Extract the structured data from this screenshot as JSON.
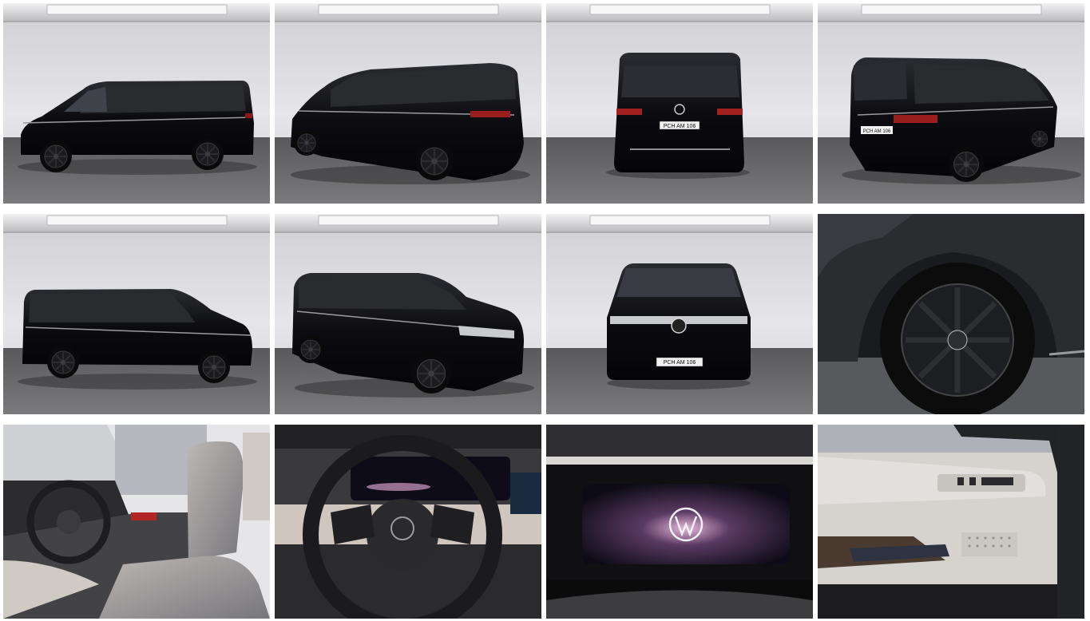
{
  "gallery": {
    "photos": [
      {
        "view": "side-left",
        "plate": ""
      },
      {
        "view": "rear-three-quarter-left",
        "plate": ""
      },
      {
        "view": "rear",
        "plate": "PCH AM 106"
      },
      {
        "view": "rear-three-quarter-right",
        "plate": "PCH AM 106"
      },
      {
        "view": "side-right",
        "plate": ""
      },
      {
        "view": "front-three-quarter-right",
        "plate": ""
      },
      {
        "view": "front",
        "plate": "PCH AM 106"
      },
      {
        "view": "wheel-closeup",
        "plate": ""
      },
      {
        "view": "interior-cockpit",
        "plate": ""
      },
      {
        "view": "steering-wheel",
        "plate": ""
      },
      {
        "view": "digital-cockpit",
        "plate": ""
      },
      {
        "view": "door-panel",
        "plate": ""
      }
    ],
    "colors": {
      "paint": "#0d0d10",
      "studio_wall": "#d9d8dc",
      "studio_floor": "#6e6e70",
      "interior_trim": "#cfcac3"
    }
  }
}
